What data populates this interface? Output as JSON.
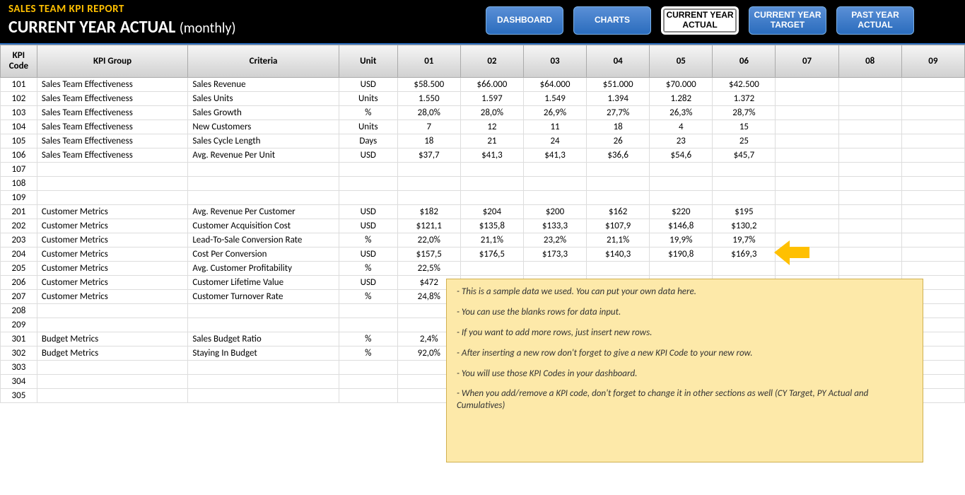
{
  "header": {
    "title_main": "SALES TEAM KPI REPORT",
    "title_sub": "CURRENT YEAR ACTUAL",
    "title_sub_light": "(monthly)"
  },
  "nav": [
    {
      "label": "DASHBOARD"
    },
    {
      "label": "CHARTS"
    },
    {
      "label": "CURRENT YEAR ACTUAL"
    },
    {
      "label": "CURRENT YEAR TARGET"
    },
    {
      "label": "PAST YEAR ACTUAL"
    }
  ],
  "columns": [
    "KPI Code",
    "KPI Group",
    "Criteria",
    "Unit",
    "01",
    "02",
    "03",
    "04",
    "05",
    "06",
    "07",
    "08",
    "09"
  ],
  "rows": [
    {
      "code": "101",
      "group": "Sales Team Effectiveness",
      "criteria": "Sales Revenue",
      "unit": "USD",
      "v": [
        "$58.500",
        "$66.000",
        "$64.000",
        "$51.000",
        "$70.000",
        "$42.500",
        "",
        "",
        ""
      ]
    },
    {
      "code": "102",
      "group": "Sales Team Effectiveness",
      "criteria": "Sales Units",
      "unit": "Units",
      "v": [
        "1.550",
        "1.597",
        "1.549",
        "1.394",
        "1.282",
        "1.372",
        "",
        "",
        ""
      ]
    },
    {
      "code": "103",
      "group": "Sales Team Effectiveness",
      "criteria": "Sales Growth",
      "unit": "%",
      "v": [
        "28,0%",
        "28,0%",
        "26,9%",
        "27,7%",
        "26,3%",
        "28,7%",
        "",
        "",
        ""
      ]
    },
    {
      "code": "104",
      "group": "Sales Team Effectiveness",
      "criteria": "New Customers",
      "unit": "Units",
      "v": [
        "7",
        "12",
        "11",
        "18",
        "4",
        "15",
        "",
        "",
        ""
      ]
    },
    {
      "code": "105",
      "group": "Sales Team Effectiveness",
      "criteria": "Sales Cycle Length",
      "unit": "Days",
      "v": [
        "18",
        "21",
        "24",
        "26",
        "23",
        "25",
        "",
        "",
        ""
      ]
    },
    {
      "code": "106",
      "group": "Sales Team Effectiveness",
      "criteria": "Avg. Revenue Per Unit",
      "unit": "USD",
      "v": [
        "$37,7",
        "$41,3",
        "$41,3",
        "$36,6",
        "$54,6",
        "$45,7",
        "",
        "",
        ""
      ]
    },
    {
      "code": "107",
      "group": "",
      "criteria": "",
      "unit": "",
      "v": [
        "",
        "",
        "",
        "",
        "",
        "",
        "",
        "",
        ""
      ]
    },
    {
      "code": "108",
      "group": "",
      "criteria": "",
      "unit": "",
      "v": [
        "",
        "",
        "",
        "",
        "",
        "",
        "",
        "",
        ""
      ]
    },
    {
      "code": "109",
      "group": "",
      "criteria": "",
      "unit": "",
      "v": [
        "",
        "",
        "",
        "",
        "",
        "",
        "",
        "",
        ""
      ]
    },
    {
      "code": "201",
      "group": "Customer Metrics",
      "criteria": "Avg. Revenue Per Customer",
      "unit": "USD",
      "v": [
        "$182",
        "$204",
        "$200",
        "$162",
        "$220",
        "$195",
        "",
        "",
        ""
      ]
    },
    {
      "code": "202",
      "group": "Customer Metrics",
      "criteria": "Customer Acquisition Cost",
      "unit": "USD",
      "v": [
        "$121,1",
        "$135,8",
        "$133,3",
        "$107,9",
        "$146,8",
        "$130,2",
        "",
        "",
        ""
      ]
    },
    {
      "code": "203",
      "group": "Customer Metrics",
      "criteria": "Lead-To-Sale Conversion Rate",
      "unit": "%",
      "v": [
        "22,0%",
        "21,1%",
        "23,2%",
        "21,1%",
        "19,9%",
        "19,7%",
        "",
        "",
        ""
      ]
    },
    {
      "code": "204",
      "group": "Customer Metrics",
      "criteria": "Cost Per Conversion",
      "unit": "USD",
      "v": [
        "$157,5",
        "$176,5",
        "$173,3",
        "$140,3",
        "$190,8",
        "$169,3",
        "",
        "",
        ""
      ]
    },
    {
      "code": "205",
      "group": "Customer Metrics",
      "criteria": "Avg. Customer Profitability",
      "unit": "%",
      "v": [
        "22,5%",
        "",
        "",
        "",
        "",
        "",
        "",
        "",
        ""
      ]
    },
    {
      "code": "206",
      "group": "Customer Metrics",
      "criteria": "Customer Lifetime Value",
      "unit": "USD",
      "v": [
        "$472",
        "",
        "",
        "",
        "",
        "",
        "",
        "",
        ""
      ]
    },
    {
      "code": "207",
      "group": "Customer Metrics",
      "criteria": "Customer Turnover Rate",
      "unit": "%",
      "v": [
        "24,8%",
        "",
        "",
        "",
        "",
        "",
        "",
        "",
        ""
      ]
    },
    {
      "code": "208",
      "group": "",
      "criteria": "",
      "unit": "",
      "v": [
        "",
        "",
        "",
        "",
        "",
        "",
        "",
        "",
        ""
      ]
    },
    {
      "code": "209",
      "group": "",
      "criteria": "",
      "unit": "",
      "v": [
        "",
        "",
        "",
        "",
        "",
        "",
        "",
        "",
        ""
      ]
    },
    {
      "code": "301",
      "group": "Budget Metrics",
      "criteria": "Sales Budget Ratio",
      "unit": "%",
      "v": [
        "2,4%",
        "",
        "",
        "",
        "",
        "",
        "",
        "",
        ""
      ]
    },
    {
      "code": "302",
      "group": "Budget Metrics",
      "criteria": "Staying In Budget",
      "unit": "%",
      "v": [
        "92,0%",
        "",
        "",
        "",
        "",
        "",
        "",
        "",
        ""
      ]
    },
    {
      "code": "303",
      "group": "",
      "criteria": "",
      "unit": "",
      "v": [
        "",
        "",
        "",
        "",
        "",
        "",
        "",
        "",
        ""
      ]
    },
    {
      "code": "304",
      "group": "",
      "criteria": "",
      "unit": "",
      "v": [
        "",
        "",
        "",
        "",
        "",
        "",
        "",
        "",
        ""
      ]
    },
    {
      "code": "305",
      "group": "",
      "criteria": "",
      "unit": "",
      "v": [
        "",
        "",
        "",
        "",
        "",
        "",
        "",
        "",
        ""
      ]
    }
  ],
  "note": [
    "- This is a sample data we used. You can put your own data here.",
    "- You can use the blanks rows for data input.",
    "- If you want to add more rows, just insert new rows.",
    "- After inserting a new row don't forget to give a new KPI Code to your new row.",
    "- You will use those KPI Codes in your dashboard.",
    "- When you add/remove a KPI code, don't forget to change it in other sections as well (CY Target, PY Actual and Cumulatives)"
  ]
}
